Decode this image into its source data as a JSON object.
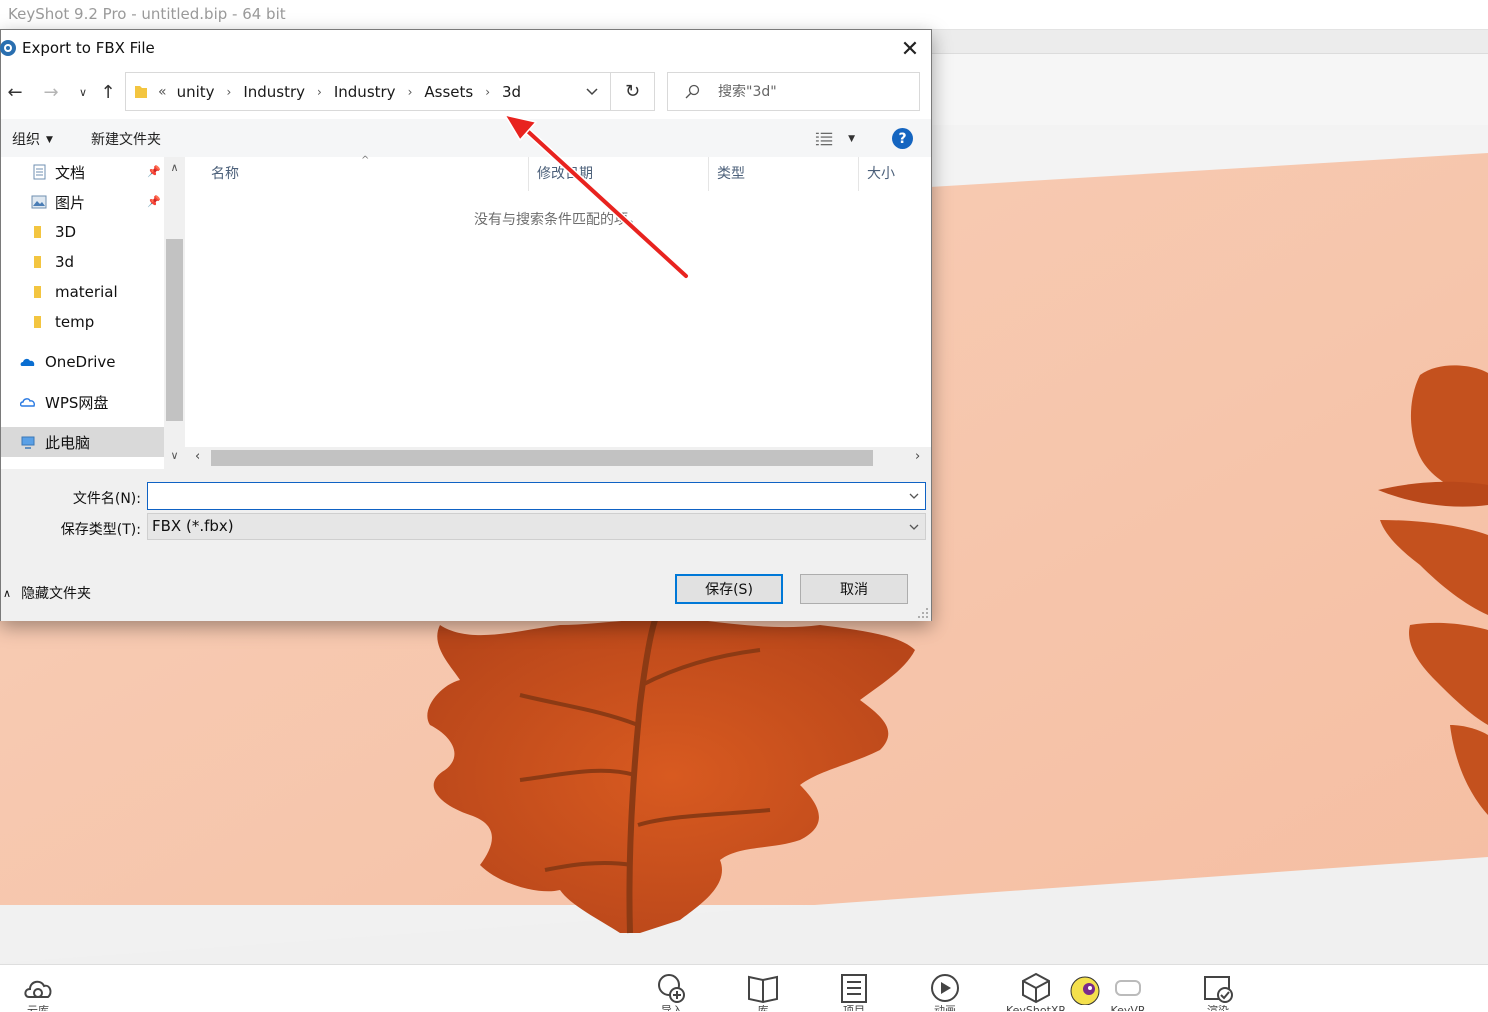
{
  "app": {
    "title": "KeyShot 9.2 Pro  - untitled.bip  - 64 bit",
    "bottom_bar": [
      {
        "icon": "cloud-icon",
        "label": "云库"
      },
      {
        "icon": "import-icon",
        "label": "导入"
      },
      {
        "icon": "library-icon",
        "label": "库"
      },
      {
        "icon": "project-icon",
        "label": "项目"
      },
      {
        "icon": "animation-icon",
        "label": "动画"
      },
      {
        "icon": "keyshotxr-icon",
        "label": "KeyShotXR"
      },
      {
        "icon": "keyvr-icon",
        "label": "KeyVR"
      },
      {
        "icon": "render-icon",
        "label": "渲染"
      }
    ]
  },
  "dialog": {
    "title": "Export to FBX File",
    "breadcrumb": [
      "unity",
      "Industry",
      "Industry",
      "Assets",
      "3d"
    ],
    "breadcrumb_overflow": "«",
    "search_placeholder": "搜索\"3d\"",
    "organize_label": "组织",
    "new_folder_label": "新建文件夹",
    "help_label": "?",
    "nav_items": [
      {
        "label": "文档",
        "icon": "documents-icon",
        "pinned": true
      },
      {
        "label": "图片",
        "icon": "pictures-icon",
        "pinned": true
      },
      {
        "label": "3D",
        "icon": "folder-icon",
        "pinned": false
      },
      {
        "label": "3d",
        "icon": "folder-icon",
        "pinned": false
      },
      {
        "label": "material",
        "icon": "folder-icon",
        "pinned": false
      },
      {
        "label": "temp",
        "icon": "folder-icon",
        "pinned": false
      },
      {
        "label": "OneDrive",
        "icon": "onedrive-icon",
        "pinned": false
      },
      {
        "label": "WPS网盘",
        "icon": "wps-cloud-icon",
        "pinned": false
      },
      {
        "label": "此电脑",
        "icon": "this-pc-icon",
        "pinned": false
      }
    ],
    "columns": [
      "名称",
      "修改日期",
      "类型",
      "大小"
    ],
    "empty_message": "没有与搜索条件匹配的项。",
    "filename_label": "文件名(N):",
    "filename_value": "",
    "filetype_label": "保存类型(T):",
    "filetype_value": "FBX (*.fbx)",
    "hide_folders_label": "隐藏文件夹",
    "save_label": "保存(S)",
    "cancel_label": "取消"
  },
  "colors": {
    "accent": "#0078d7",
    "annotation_arrow": "#e8231f",
    "floor": "#f7c3a8",
    "leaf": "#c8501d"
  }
}
